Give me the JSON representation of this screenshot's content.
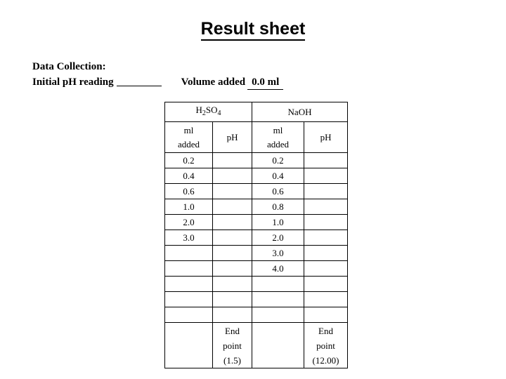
{
  "title": "Result sheet",
  "data_collection": {
    "heading": "Data Collection:",
    "initial_ph_label": "Initial pH reading",
    "initial_ph_value": "",
    "volume_added_label": "Volume added",
    "volume_added_value": "0.0 ml"
  },
  "table": {
    "groups": [
      {
        "name": "H2SO4",
        "formula_main": "H",
        "sub1": "2",
        "mid": "SO",
        "sub2": "4"
      },
      {
        "name": "NaOH"
      }
    ],
    "group_labels": [
      "H2SO4",
      "NaOH"
    ],
    "subheaders": {
      "ml_line1": "ml",
      "ml_line2": "added",
      "ph": "pH"
    },
    "rows": [
      {
        "h2so4_ml": "0.2",
        "h2so4_ph": "",
        "naoh_ml": "0.2",
        "naoh_ph": ""
      },
      {
        "h2so4_ml": "0.4",
        "h2so4_ph": "",
        "naoh_ml": "0.4",
        "naoh_ph": ""
      },
      {
        "h2so4_ml": "0.6",
        "h2so4_ph": "",
        "naoh_ml": "0.6",
        "naoh_ph": ""
      },
      {
        "h2so4_ml": "1.0",
        "h2so4_ph": "",
        "naoh_ml": "0.8",
        "naoh_ph": ""
      },
      {
        "h2so4_ml": "2.0",
        "h2so4_ph": "",
        "naoh_ml": "1.0",
        "naoh_ph": ""
      },
      {
        "h2so4_ml": "3.0",
        "h2so4_ph": "",
        "naoh_ml": "2.0",
        "naoh_ph": ""
      },
      {
        "h2so4_ml": "",
        "h2so4_ph": "",
        "naoh_ml": "3.0",
        "naoh_ph": ""
      },
      {
        "h2so4_ml": "",
        "h2so4_ph": "",
        "naoh_ml": "4.0",
        "naoh_ph": ""
      },
      {
        "h2so4_ml": "",
        "h2so4_ph": "",
        "naoh_ml": "",
        "naoh_ph": ""
      },
      {
        "h2so4_ml": "",
        "h2so4_ph": "",
        "naoh_ml": "",
        "naoh_ph": ""
      },
      {
        "h2so4_ml": "",
        "h2so4_ph": "",
        "naoh_ml": "",
        "naoh_ph": ""
      }
    ],
    "endpoint_row": {
      "h2so4_ml": "",
      "h2so4_ph_line1": "End",
      "h2so4_ph_line2": "point",
      "h2so4_ph_line3": "(1.5)",
      "naoh_ml": "",
      "naoh_ph_line1": "End",
      "naoh_ph_line2": "point",
      "naoh_ph_line3": "(12.00)"
    }
  },
  "colors": {
    "text": "#000000",
    "background": "#ffffff",
    "border": "#000000"
  }
}
